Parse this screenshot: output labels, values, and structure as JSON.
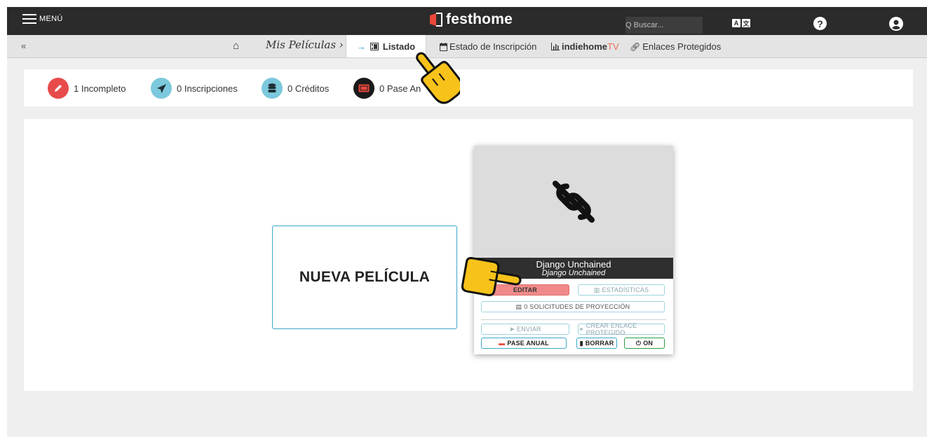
{
  "topbar": {
    "menu_label": "MENÚ",
    "logo_text": "festhome",
    "search_placeholder": "Q Buscar...",
    "lang_icon": [
      "A",
      "文"
    ],
    "help_icon": "?"
  },
  "subnav": {
    "back": "«",
    "home_icon": "⌂",
    "mis_peliculas": "Mis Películas ›",
    "listado_arrow": "→",
    "listado_label": "Listado",
    "estado_label": "Estado de Inscripción",
    "indiehome_label": "indiehome",
    "indiehome_tv": "TV",
    "enlaces_label": "Enlaces Protegidos"
  },
  "stats": {
    "incompleto": "1 Incompleto",
    "inscripciones": "0 Inscripciones",
    "creditos": "0 Créditos",
    "pase_anual": "0 Pase An"
  },
  "main": {
    "new_film_label": "NUEVA PELÍCULA",
    "card": {
      "title": "Django Unchained",
      "subtitle": "Django Unchained",
      "edit_label": "EDITAR",
      "stats_label": "ESTADÍSTICAS",
      "solicitudes_label": "0 SOLICITUDES DE PROYECCIÓN",
      "enviar_label": "ENVIAR",
      "crear_enlace_label": "CREAR ENLACE PROTEGIDO",
      "pase_anual_label": "PASE ANUAL",
      "borrar_label": "BORRAR",
      "on_label": "ON"
    }
  },
  "colors": {
    "topbar": "#2b2b2b",
    "accent": "#1aa3c6",
    "logo_red": "#e8473a",
    "incompleto": "#e84b4b",
    "inscripciones": "#7cc8dc",
    "creditos": "#7cc8dc",
    "pase": "#1a1a1a",
    "pointer": "#f7c21a"
  },
  "icons": {
    "menu": "hamburger-icon",
    "logo": "festhome-logo-icon",
    "search": "search-icon",
    "language": "translate-icon",
    "help": "question-circle-icon",
    "user": "user-circle-icon",
    "home": "home-icon",
    "listado": "film-list-icon",
    "estado": "calendar-icon",
    "indiehome": "chart-icon",
    "enlaces": "link-icon",
    "incompleto": "pencil-icon",
    "inscripciones": "paper-plane-icon",
    "creditos": "database-icon",
    "pase_anual": "ticket-icon",
    "thumbnail": "broken-link-icon",
    "pointer": "pointing-hand-icon"
  }
}
